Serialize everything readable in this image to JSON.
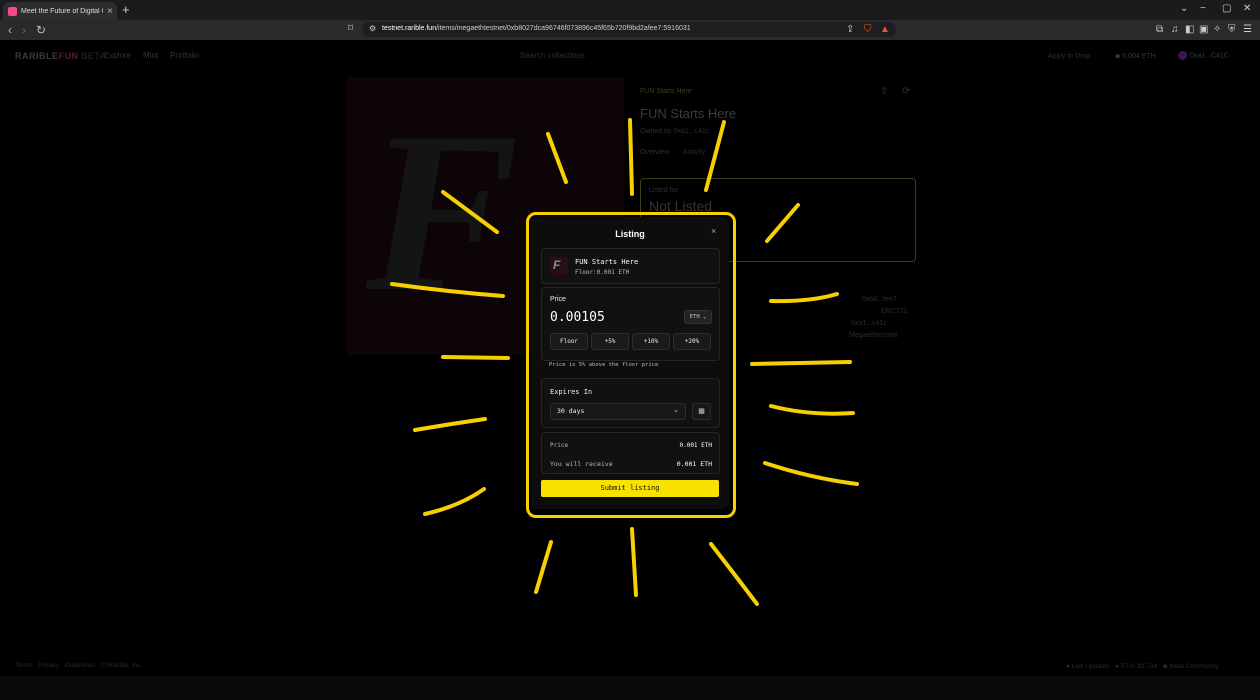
{
  "browser": {
    "tab_title": "Meet the Future of Digital Colle",
    "tab_close": "×",
    "new_tab": "+",
    "url_domain": "testnet.rarible.fun",
    "url_path": "/items/megaethtestnet/0xb8027dca96746f073896c45f65b720f9bd2afee7:5916031",
    "window_controls": [
      "⌄",
      "−",
      "▢",
      "✕"
    ]
  },
  "site": {
    "logo_text": "RARIBLE",
    "logo_fun": "FUN",
    "logo_beta": "BETA",
    "nav": [
      "Explore",
      "Mint",
      "Portfolio"
    ],
    "search_placeholder": "Search collections",
    "apply_to_drop": "Apply to Drop",
    "eth_balance": "0.004 ETH",
    "account": "0xa1...C41C"
  },
  "item": {
    "breadcrumb": "FUN Starts Here",
    "title": "FUN Starts Here",
    "owned_by_label": "Owned by",
    "owned_by": "0xa1...c41c",
    "tabs": [
      "Overview",
      "Activity"
    ],
    "listed_for_label": "Listed for",
    "listed_status": "Not Listed",
    "details": [
      "0xb8...fee7",
      "ERC721",
      "0xa1...c41c",
      "Megaethtestnet"
    ]
  },
  "footer": {
    "links": [
      "Terms",
      "Privacy",
      "Guidelines",
      "© Rarible, Inc."
    ],
    "right": [
      "Live Updates",
      "ETH: $1,734",
      "Meta Community"
    ]
  },
  "modal": {
    "title": "Listing",
    "close": "×",
    "nft_name": "FUN Starts Here",
    "floor_text": "Floor:0.001 ETH",
    "price_label": "Price",
    "price_value": "0.00105",
    "currency": "ETH",
    "price_buttons": [
      "Floor",
      "+5%",
      "+10%",
      "+20%"
    ],
    "price_hint": "Price is 5% above the floor price",
    "expires_label": "Expires In",
    "expires_value": "30 days",
    "summary": [
      {
        "label": "Price",
        "value": "0.001 ETH"
      },
      {
        "label": "You will receive",
        "value": "0.001 ETH"
      }
    ],
    "submit_label": "Submit listing"
  },
  "colors": {
    "accent": "#f7e200",
    "annotation": "#f7d000",
    "background": "#000000"
  }
}
